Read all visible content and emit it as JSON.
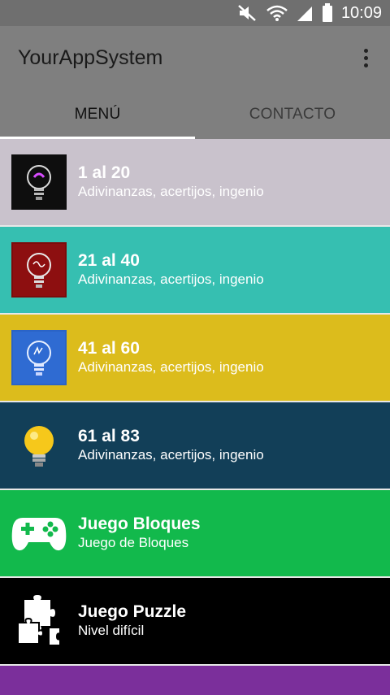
{
  "status_bar": {
    "time": "10:09",
    "icons": [
      "mute-icon",
      "wifi-icon",
      "signal-icon",
      "battery-icon"
    ]
  },
  "app_bar": {
    "title": "YourAppSystem",
    "overflow_icon": "more-vert-icon"
  },
  "tabs": [
    {
      "label": "MENÚ",
      "active": true
    },
    {
      "label": "CONTACTO",
      "active": false
    }
  ],
  "items": [
    {
      "title": "1 al 20",
      "subtitle": "Adivinanzas, acertijos, ingenio",
      "bg": "#c9c2cc",
      "icon": "lightbulb-purple-icon"
    },
    {
      "title": "21 al 40",
      "subtitle": "Adivinanzas, acertijos, ingenio",
      "bg": "#36bfb1",
      "icon": "lightbulb-red-icon"
    },
    {
      "title": "41 al 60",
      "subtitle": "Adivinanzas, acertijos, ingenio",
      "bg": "#dcbc1c",
      "icon": "lightbulb-blue-icon"
    },
    {
      "title": "61 al 83",
      "subtitle": "Adivinanzas, acertijos, ingenio",
      "bg": "#123f58",
      "icon": "lightbulb-yellow-icon"
    },
    {
      "title": "Juego Bloques",
      "subtitle": "Juego de Bloques",
      "bg": "#12b94c",
      "icon": "gamepad-icon"
    },
    {
      "title": "Juego Puzzle",
      "subtitle": "Nivel difícil",
      "bg": "#000000",
      "icon": "puzzle-icon"
    }
  ],
  "partial_item": {
    "bg": "#7b2f9b"
  }
}
